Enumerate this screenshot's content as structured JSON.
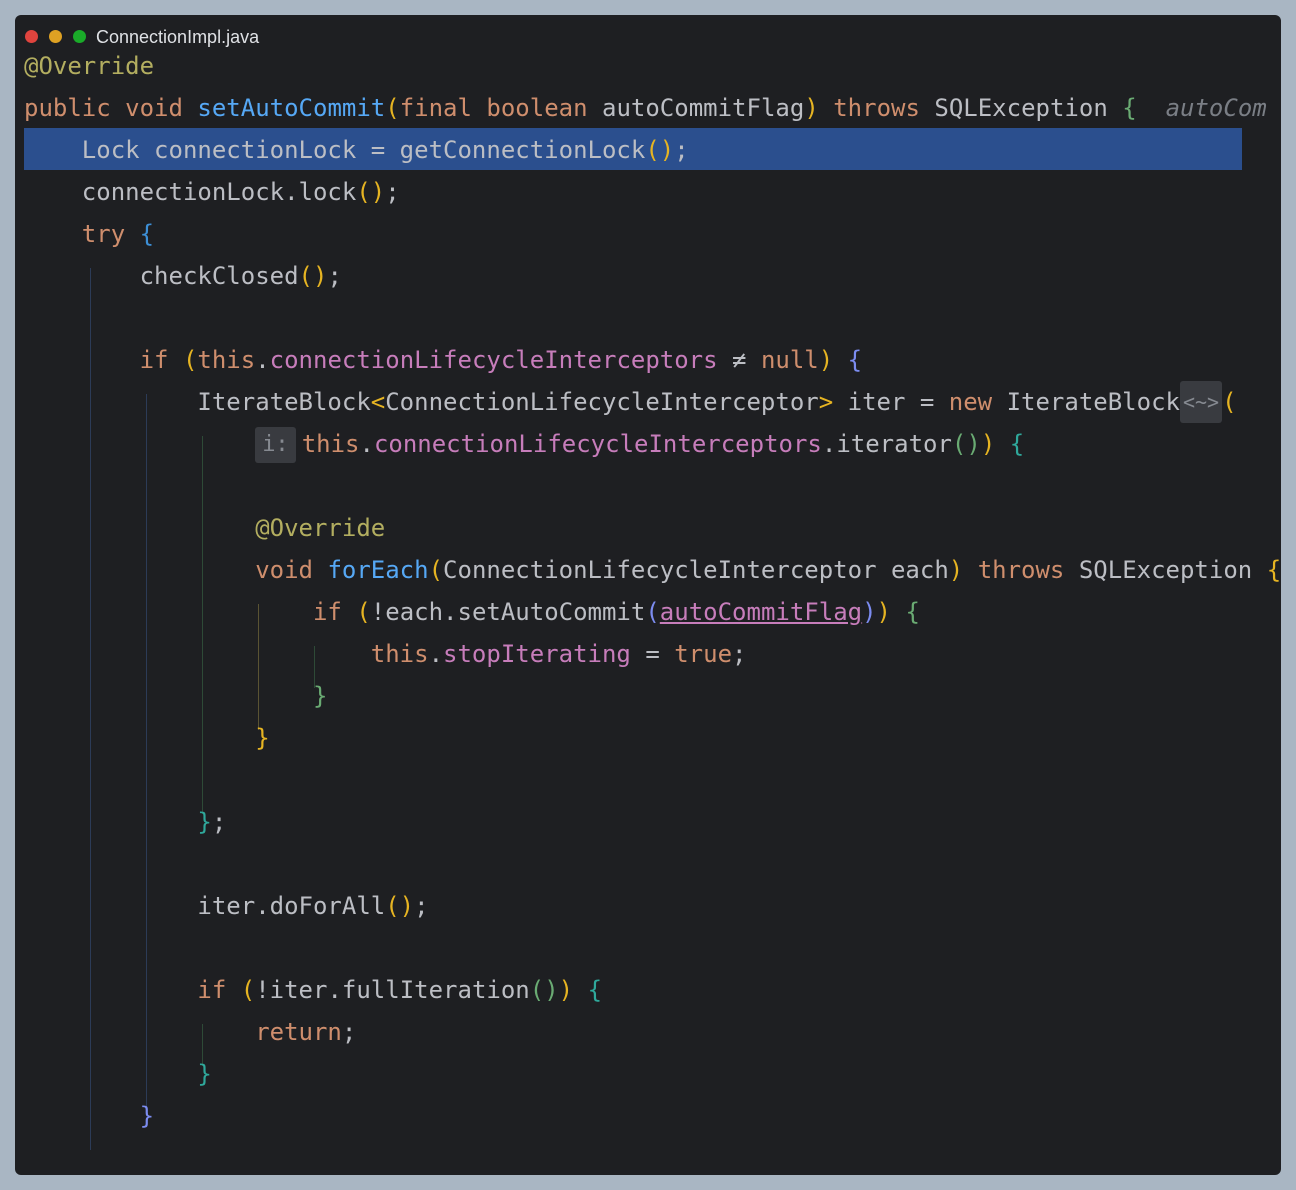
{
  "window": {
    "filename": "ConnectionImpl.java",
    "controls": {
      "close_color": "#e0443e",
      "minimize_color": "#dea123",
      "zoom_color": "#1aab29"
    }
  },
  "editor": {
    "background": "#1e1f22",
    "selection_color": "#2b4f8e",
    "lines": [
      {
        "id": "l1",
        "tokens": [
          {
            "c": "ann",
            "t": "@Override"
          }
        ]
      },
      {
        "id": "l2",
        "tokens": [
          {
            "c": "kw",
            "t": "public"
          },
          {
            "c": "txt",
            "t": " "
          },
          {
            "c": "kw",
            "t": "void"
          },
          {
            "c": "txt",
            "t": " "
          },
          {
            "c": "fn",
            "t": "setAutoCommit"
          },
          {
            "c": "b",
            "k": "y",
            "t": "("
          },
          {
            "c": "kw",
            "t": "final"
          },
          {
            "c": "txt",
            "t": " "
          },
          {
            "c": "kw",
            "t": "boolean"
          },
          {
            "c": "txt",
            "t": " autoCommitFlag"
          },
          {
            "c": "b",
            "k": "y",
            "t": ")"
          },
          {
            "c": "txt",
            "t": " "
          },
          {
            "c": "kw",
            "t": "throws"
          },
          {
            "c": "txt",
            "t": " SQLException "
          },
          {
            "c": "b",
            "k": "g",
            "t": "{"
          },
          {
            "c": "txt",
            "t": "  "
          },
          {
            "c": "hint",
            "t": "autoCom"
          }
        ]
      },
      {
        "id": "l3",
        "tokens": [
          {
            "c": "txt",
            "t": "    Lock connectionLock = getConnectionLock"
          },
          {
            "c": "b",
            "k": "y",
            "t": "()"
          },
          {
            "c": "txt",
            "t": ";"
          }
        ]
      },
      {
        "id": "l4",
        "tokens": [
          {
            "c": "txt",
            "t": "    connectionLock.lock"
          },
          {
            "c": "b",
            "k": "y",
            "t": "()"
          },
          {
            "c": "txt",
            "t": ";"
          }
        ]
      },
      {
        "id": "l5",
        "tokens": [
          {
            "c": "txt",
            "t": "    "
          },
          {
            "c": "kw",
            "t": "try"
          },
          {
            "c": "txt",
            "t": " "
          },
          {
            "c": "b",
            "k": "b",
            "t": "{"
          }
        ]
      },
      {
        "id": "l6",
        "tokens": [
          {
            "c": "txt",
            "t": "        checkClosed"
          },
          {
            "c": "b",
            "k": "y",
            "t": "()"
          },
          {
            "c": "txt",
            "t": ";"
          }
        ]
      },
      {
        "id": "l7",
        "tokens": []
      },
      {
        "id": "l8",
        "tokens": [
          {
            "c": "txt",
            "t": "        "
          },
          {
            "c": "kw",
            "t": "if"
          },
          {
            "c": "txt",
            "t": " "
          },
          {
            "c": "b",
            "k": "y",
            "t": "("
          },
          {
            "c": "kw",
            "t": "this"
          },
          {
            "c": "txt",
            "t": "."
          },
          {
            "c": "fld",
            "t": "connectionLifecycleInterceptors"
          },
          {
            "c": "txt",
            "t": " ≠ "
          },
          {
            "c": "kw",
            "t": "null"
          },
          {
            "c": "b",
            "k": "y",
            "t": ")"
          },
          {
            "c": "txt",
            "t": " "
          },
          {
            "c": "b",
            "k": "v",
            "t": "{"
          }
        ]
      },
      {
        "id": "l9",
        "tokens": [
          {
            "c": "txt",
            "t": "            IterateBlock"
          },
          {
            "c": "b",
            "k": "y",
            "t": "<"
          },
          {
            "c": "txt",
            "t": "ConnectionLifecycleInterceptor"
          },
          {
            "c": "b",
            "k": "y",
            "t": ">"
          },
          {
            "c": "txt",
            "t": " iter = "
          },
          {
            "c": "kw",
            "t": "new"
          },
          {
            "c": "txt",
            "t": " IterateBlock"
          },
          {
            "c": "diamond",
            "t": "<~>"
          },
          {
            "c": "b",
            "k": "y",
            "t": "("
          }
        ]
      },
      {
        "id": "l10",
        "tokens": [
          {
            "c": "txt",
            "t": "                "
          },
          {
            "c": "inlay",
            "t": "i:"
          },
          {
            "c": "kw",
            "t": "this"
          },
          {
            "c": "txt",
            "t": "."
          },
          {
            "c": "fld",
            "t": "connectionLifecycleInterceptors"
          },
          {
            "c": "txt",
            "t": ".iterator"
          },
          {
            "c": "b",
            "k": "g",
            "t": "()"
          },
          {
            "c": "b",
            "k": "y",
            "t": ")"
          },
          {
            "c": "txt",
            "t": " "
          },
          {
            "c": "b",
            "k": "t",
            "t": "{"
          }
        ]
      },
      {
        "id": "l11",
        "tokens": []
      },
      {
        "id": "l12",
        "tokens": [
          {
            "c": "txt",
            "t": "                "
          },
          {
            "c": "ann",
            "t": "@Override"
          }
        ]
      },
      {
        "id": "l13",
        "tokens": [
          {
            "c": "txt",
            "t": "                "
          },
          {
            "c": "kw",
            "t": "void"
          },
          {
            "c": "txt",
            "t": " "
          },
          {
            "c": "fn",
            "t": "forEach"
          },
          {
            "c": "b",
            "k": "y",
            "t": "("
          },
          {
            "c": "txt",
            "t": "ConnectionLifecycleInterceptor each"
          },
          {
            "c": "b",
            "k": "y",
            "t": ")"
          },
          {
            "c": "txt",
            "t": " "
          },
          {
            "c": "kw",
            "t": "throws"
          },
          {
            "c": "txt",
            "t": " SQLException "
          },
          {
            "c": "b",
            "k": "y",
            "t": "{"
          }
        ]
      },
      {
        "id": "l14",
        "tokens": [
          {
            "c": "txt",
            "t": "                    "
          },
          {
            "c": "kw",
            "t": "if"
          },
          {
            "c": "txt",
            "t": " "
          },
          {
            "c": "b",
            "k": "y",
            "t": "("
          },
          {
            "c": "txt",
            "t": "!each.setAutoCommit"
          },
          {
            "c": "b",
            "k": "v",
            "t": "("
          },
          {
            "c": "fld undl",
            "t": "autoCommitFlag"
          },
          {
            "c": "b",
            "k": "v",
            "t": ")"
          },
          {
            "c": "b",
            "k": "y",
            "t": ")"
          },
          {
            "c": "txt",
            "t": " "
          },
          {
            "c": "b",
            "k": "g",
            "t": "{"
          }
        ]
      },
      {
        "id": "l15",
        "tokens": [
          {
            "c": "txt",
            "t": "                        "
          },
          {
            "c": "kw",
            "t": "this"
          },
          {
            "c": "txt",
            "t": "."
          },
          {
            "c": "fld",
            "t": "stopIterating"
          },
          {
            "c": "txt",
            "t": " = "
          },
          {
            "c": "kw",
            "t": "true"
          },
          {
            "c": "txt",
            "t": ";"
          }
        ]
      },
      {
        "id": "l16",
        "tokens": [
          {
            "c": "txt",
            "t": "                    "
          },
          {
            "c": "b",
            "k": "g",
            "t": "}"
          }
        ]
      },
      {
        "id": "l17",
        "tokens": [
          {
            "c": "txt",
            "t": "                "
          },
          {
            "c": "b",
            "k": "y",
            "t": "}"
          }
        ]
      },
      {
        "id": "l18",
        "tokens": []
      },
      {
        "id": "l19",
        "tokens": [
          {
            "c": "txt",
            "t": "            "
          },
          {
            "c": "b",
            "k": "t",
            "t": "}"
          },
          {
            "c": "txt",
            "t": ";"
          }
        ]
      },
      {
        "id": "l20",
        "tokens": []
      },
      {
        "id": "l21",
        "tokens": [
          {
            "c": "txt",
            "t": "            iter.doForAll"
          },
          {
            "c": "b",
            "k": "y",
            "t": "()"
          },
          {
            "c": "txt",
            "t": ";"
          }
        ]
      },
      {
        "id": "l22",
        "tokens": []
      },
      {
        "id": "l23",
        "tokens": [
          {
            "c": "txt",
            "t": "            "
          },
          {
            "c": "kw",
            "t": "if"
          },
          {
            "c": "txt",
            "t": " "
          },
          {
            "c": "b",
            "k": "y",
            "t": "("
          },
          {
            "c": "txt",
            "t": "!iter.fullIteration"
          },
          {
            "c": "b",
            "k": "g",
            "t": "()"
          },
          {
            "c": "b",
            "k": "y",
            "t": ")"
          },
          {
            "c": "txt",
            "t": " "
          },
          {
            "c": "b",
            "k": "t",
            "t": "{"
          }
        ]
      },
      {
        "id": "l24",
        "tokens": [
          {
            "c": "txt",
            "t": "                "
          },
          {
            "c": "kw",
            "t": "return"
          },
          {
            "c": "txt",
            "t": ";"
          }
        ]
      },
      {
        "id": "l25",
        "tokens": [
          {
            "c": "txt",
            "t": "            "
          },
          {
            "c": "b",
            "k": "t",
            "t": "}"
          }
        ]
      },
      {
        "id": "l26",
        "tokens": [
          {
            "c": "txt",
            "t": "        "
          },
          {
            "c": "b",
            "k": "v",
            "t": "}"
          }
        ]
      }
    ]
  },
  "colors": {
    "bracket_y": "#e6b422",
    "bracket_g": "#6aab73",
    "bracket_b": "#3d8fd6",
    "bracket_v": "#7c8cf0",
    "bracket_t": "#2fa89b",
    "guide_blue": "#2c3b57",
    "guide_green": "#2e4a37",
    "guide_olive": "#5a5333"
  }
}
